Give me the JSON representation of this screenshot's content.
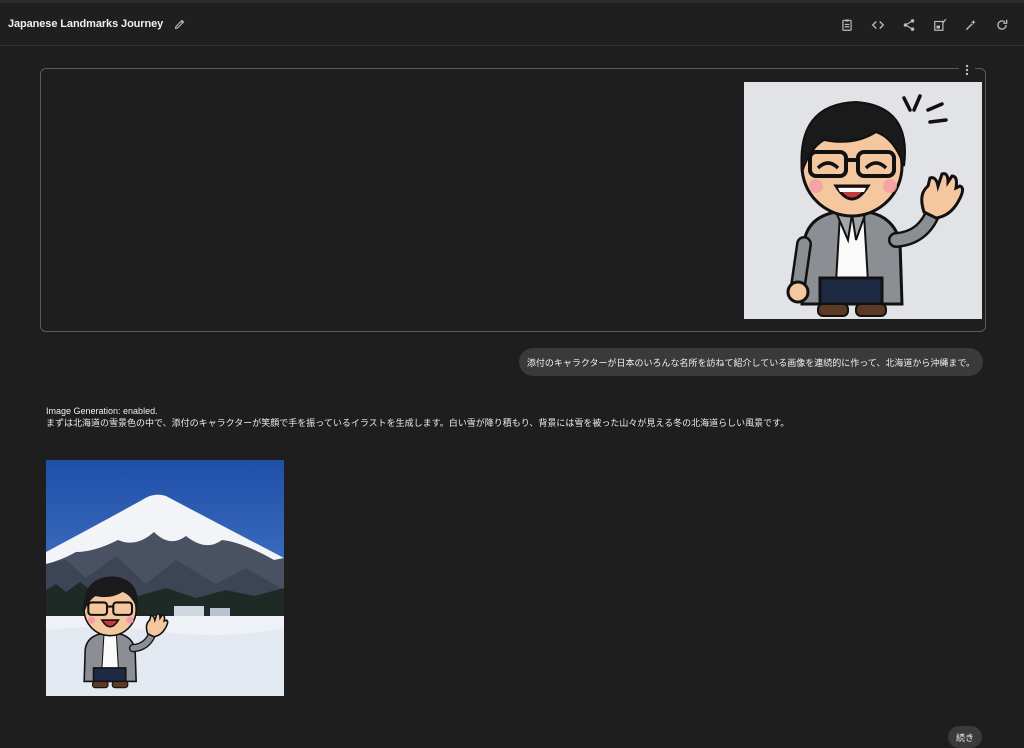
{
  "header": {
    "title": "Japanese Landmarks Journey",
    "edit_icon": "pencil-icon",
    "toolbar_icons": [
      "clipboard-icon",
      "code-icon",
      "share-icon",
      "compare-icon",
      "magic-icon",
      "refresh-icon"
    ]
  },
  "prompt_panel": {
    "menu_icon": "more-vertical-icon",
    "attachment": "character illustration: smiling man with glasses, gray blazer, waving"
  },
  "user_message": "添付のキャラクターが日本のいろんな名所を訪ねて紹介している画像を連続的に作って、北海道から沖縄まで。",
  "response": {
    "status_line": "Image Generation: enabled.",
    "text": "まずは北海道の雪景色の中で、添付のキャラクターが笑顔で手を振っているイラストを生成します。白い雪が降り積もり、背景には雪を被った山々が見える冬の北海道らしい風景です。"
  },
  "continue_button": "続き",
  "colors": {
    "background": "#1e1e1e",
    "bubble": "#3a3a3a",
    "border": "#5b5b5b"
  }
}
